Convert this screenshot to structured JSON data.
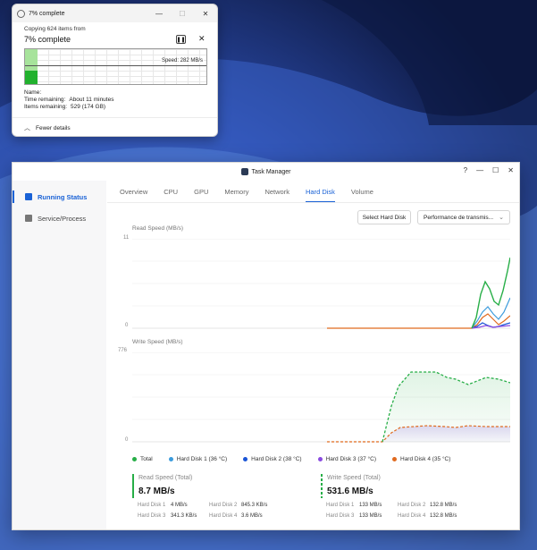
{
  "copy_dialog": {
    "title": "7% complete",
    "from_text": "Copying 624 items from",
    "progress_text": "7% complete",
    "pause_icon": "pause-icon",
    "speed_label": "Speed: 282 MB/s",
    "progress_fraction": 0.07,
    "details": [
      {
        "key": "Name:",
        "value": ""
      },
      {
        "key": "Time remaining:",
        "value": "About 11 minutes"
      },
      {
        "key": "Items remaining:",
        "value": "529 (174 GB)"
      }
    ],
    "fewer_details": "Fewer details",
    "close_symbol": "✕",
    "minimize_symbol": "—",
    "maximize_symbol": "☐"
  },
  "task_manager": {
    "title": "Task Manager",
    "help_symbol": "?",
    "minimize_symbol": "—",
    "maximize_symbol": "☐",
    "close_symbol": "✕",
    "sidebar": [
      {
        "label": "Running Status",
        "active": true
      },
      {
        "label": "Service/Process",
        "active": false
      }
    ],
    "tabs": [
      "Overview",
      "CPU",
      "GPU",
      "Memory",
      "Network",
      "Hard Disk",
      "Volume"
    ],
    "active_tab": "Hard Disk",
    "select_disk_button": "Select Hard Disk",
    "perf_dropdown": "Performance de transmis...",
    "read_chart": {
      "label": "Read Speed  (MB/s)",
      "max_tick": "11",
      "min_tick": "0"
    },
    "write_chart": {
      "label": "Write Speed  (MB/s)",
      "max_tick": "776",
      "min_tick": "0"
    },
    "legend": [
      {
        "label": "Total",
        "color": "#27ae47"
      },
      {
        "label": "Hard Disk 1 (36 °C)",
        "color": "#3b9bdc"
      },
      {
        "label": "Hard Disk 2 (38 °C)",
        "color": "#1a55d6"
      },
      {
        "label": "Hard Disk 3 (37 °C)",
        "color": "#8a4be0"
      },
      {
        "label": "Hard Disk 4 (35 °C)",
        "color": "#e06a1f"
      }
    ],
    "read_summary": {
      "title": "Read Speed (Total)",
      "value": "8.7 MB/s",
      "disks": [
        {
          "label": "Hard Disk 1",
          "value": "4 MB/s"
        },
        {
          "label": "Hard Disk 2",
          "value": "845.3 KB/s"
        },
        {
          "label": "Hard Disk 3",
          "value": "341.3 KB/s"
        },
        {
          "label": "Hard Disk 4",
          "value": "3.6 MB/s"
        }
      ]
    },
    "write_summary": {
      "title": "Write Speed (Total)",
      "value": "531.6 MB/s",
      "disks": [
        {
          "label": "Hard Disk 1",
          "value": "133 MB/s"
        },
        {
          "label": "Hard Disk 2",
          "value": "132.8 MB/s"
        },
        {
          "label": "Hard Disk 3",
          "value": "133 MB/s"
        },
        {
          "label": "Hard Disk 4",
          "value": "132.8 MB/s"
        }
      ]
    }
  },
  "colors": {
    "accent": "#1a62d6",
    "total_green": "#27ae47",
    "progress_light": "#a7e39b",
    "progress_dark": "#21b12d"
  }
}
